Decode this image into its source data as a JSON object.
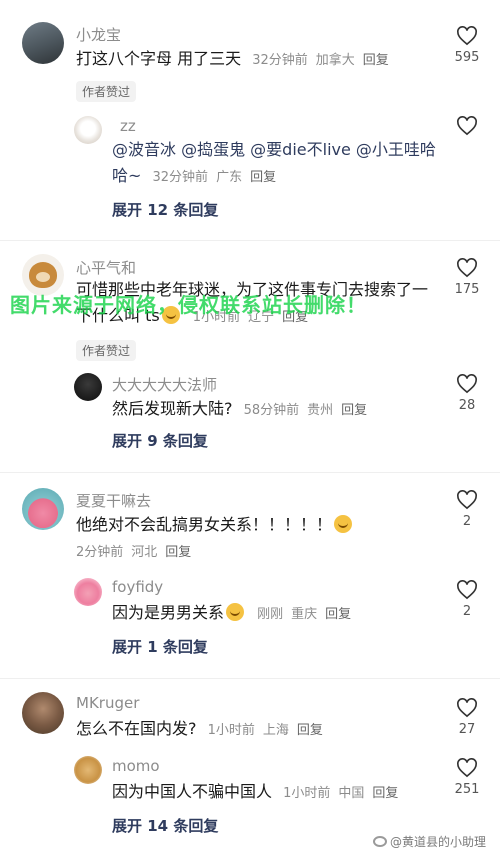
{
  "author_liked_label": "作者赞过",
  "comments": [
    {
      "user": "小龙宝",
      "text": "打这八个字母 用了三天",
      "time": "32分钟前",
      "location": "加拿大",
      "reply_label": "回复",
      "likes": "595",
      "reply": {
        "user": "zz",
        "mentions": "@波音冰 @捣蛋鬼 @要die不live @小王哇哈哈~",
        "time": "32分钟前",
        "location": "广东",
        "reply_label": "回复"
      },
      "expand": "展开 12 条回复"
    },
    {
      "user": "心平气和",
      "text": "可惜那些中老年球迷，为了这件事专门去搜索了一下什么叫 ts",
      "time": "1小时前",
      "location": "辽宁",
      "reply_label": "回复",
      "likes": "175",
      "reply": {
        "user": "大大大大大法师",
        "text": "然后发现新大陆?",
        "time": "58分钟前",
        "location": "贵州",
        "reply_label": "回复",
        "likes": "28"
      },
      "expand": "展开 9 条回复"
    },
    {
      "user": "夏夏干嘛去",
      "text": "他绝对不会乱搞男女关系！！！！！",
      "time": "2分钟前",
      "location": "河北",
      "reply_label": "回复",
      "likes": "2",
      "reply": {
        "user": "foyfidy",
        "text": "因为是男男关系",
        "time": "刚刚",
        "location": "重庆",
        "reply_label": "回复",
        "likes": "2"
      },
      "expand": "展开 1 条回复"
    },
    {
      "user": "MKruger",
      "text": "怎么不在国内发?",
      "time": "1小时前",
      "location": "上海",
      "reply_label": "回复",
      "likes": "27",
      "reply": {
        "user": "momo",
        "text": "因为中国人不骗中国人",
        "time": "1小时前",
        "location": "中国",
        "reply_label": "回复",
        "likes": "251"
      },
      "expand": "展开 14 条回复"
    }
  ],
  "watermark": "图片来源于网络，侵权联系站长删除！",
  "footer_watermark": "@黄道县的小助理",
  "colors": {
    "watermark": "#14d246",
    "expand": "#2f3c5e",
    "meta": "#8c8c8c"
  },
  "icons": [
    "heart-outline-icon",
    "emoji-icon",
    "weibo-icon"
  ]
}
